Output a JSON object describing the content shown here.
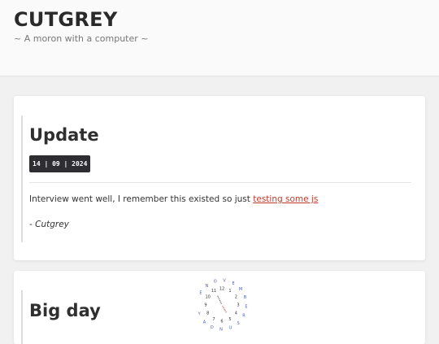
{
  "header": {
    "title": "CUTGREY",
    "tagline": "~ A moron with a computer ~"
  },
  "posts": [
    {
      "title": "Update",
      "date": "14 | 09 | 2024",
      "body": "Interview went well, I remember this existed so just ",
      "link_text": "testing some js",
      "signature": "- Cutgrey"
    },
    {
      "title": "Big day"
    }
  ],
  "clock": {
    "hour_labels": [
      "12",
      "1",
      "2",
      "3",
      "4",
      "5",
      "6",
      "7",
      "8",
      "9",
      "10",
      "11"
    ],
    "month_letters": [
      "E",
      "N",
      "O",
      "V",
      "E",
      "M",
      "B",
      "E",
      "R",
      "S",
      "U",
      "N",
      "D",
      "A",
      "Y"
    ],
    "accent_color": "#4b5bb5"
  }
}
